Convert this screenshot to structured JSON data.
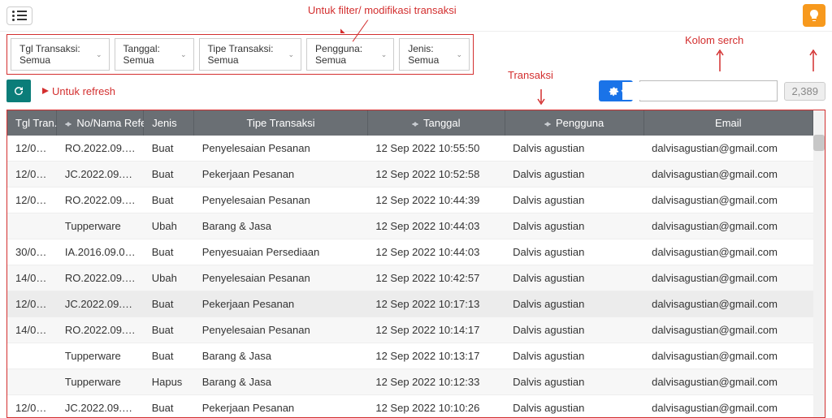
{
  "annotations": {
    "filter": "Untuk filter/ modifikasi transaksi",
    "refresh": "Untuk refresh",
    "transaksi": "Transaksi",
    "search": "Kolom serch"
  },
  "filters": [
    {
      "label": "Tgl Transaksi: Semua"
    },
    {
      "label": "Tanggal: Semua"
    },
    {
      "label": "Tipe Transaksi: Semua"
    },
    {
      "label": "Pengguna: Semua"
    },
    {
      "label": "Jenis: Semua"
    }
  ],
  "search": {
    "placeholder": "",
    "value": ""
  },
  "count": "2,389",
  "columns": [
    {
      "label": "Tgl Tran...",
      "sortable": false,
      "width": "col-tgl"
    },
    {
      "label": "No/Nama Refer...",
      "sortable": true,
      "width": "col-nama"
    },
    {
      "label": "Jenis",
      "sortable": false,
      "width": "col-jenis"
    },
    {
      "label": "Tipe Transaksi",
      "sortable": false,
      "center": true,
      "width": "col-tipe"
    },
    {
      "label": "Tanggal",
      "sortable": true,
      "center": true,
      "width": "col-tanggal"
    },
    {
      "label": "Pengguna",
      "sortable": true,
      "center": true,
      "width": "col-pengguna"
    },
    {
      "label": "Email",
      "sortable": false,
      "center": true,
      "width": "col-email"
    }
  ],
  "rows": [
    {
      "tgl": "12/09/...",
      "nama": "RO.2022.09.0...",
      "jenis": "Buat",
      "tipe": "Penyelesaian Pesanan",
      "tanggal": "12 Sep 2022 10:55:50",
      "pengguna": "Dalvis agustian",
      "email": "dalvisagustian@gmail.com"
    },
    {
      "tgl": "12/09/...",
      "nama": "JC.2022.09.00...",
      "jenis": "Buat",
      "tipe": "Pekerjaan Pesanan",
      "tanggal": "12 Sep 2022 10:52:58",
      "pengguna": "Dalvis agustian",
      "email": "dalvisagustian@gmail.com"
    },
    {
      "tgl": "12/09/...",
      "nama": "RO.2022.09.0...",
      "jenis": "Buat",
      "tipe": "Penyelesaian Pesanan",
      "tanggal": "12 Sep 2022 10:44:39",
      "pengguna": "Dalvis agustian",
      "email": "dalvisagustian@gmail.com"
    },
    {
      "tgl": "",
      "nama": "Tupperware",
      "jenis": "Ubah",
      "tipe": "Barang & Jasa",
      "tanggal": "12 Sep 2022 10:44:03",
      "pengguna": "Dalvis agustian",
      "email": "dalvisagustian@gmail.com"
    },
    {
      "tgl": "30/09/...",
      "nama": "IA.2016.09.00...",
      "jenis": "Buat",
      "tipe": "Penyesuaian Persediaan",
      "tanggal": "12 Sep 2022 10:44:03",
      "pengguna": "Dalvis agustian",
      "email": "dalvisagustian@gmail.com"
    },
    {
      "tgl": "14/09/...",
      "nama": "RO.2022.09.0...",
      "jenis": "Ubah",
      "tipe": "Penyelesaian Pesanan",
      "tanggal": "12 Sep 2022 10:42:57",
      "pengguna": "Dalvis agustian",
      "email": "dalvisagustian@gmail.com"
    },
    {
      "tgl": "12/09/...",
      "nama": "JC.2022.09.00...",
      "jenis": "Buat",
      "tipe": "Pekerjaan Pesanan",
      "tanggal": "12 Sep 2022 10:17:13",
      "pengguna": "Dalvis agustian",
      "email": "dalvisagustian@gmail.com",
      "hl": true
    },
    {
      "tgl": "14/09/...",
      "nama": "RO.2022.09.0...",
      "jenis": "Buat",
      "tipe": "Penyelesaian Pesanan",
      "tanggal": "12 Sep 2022 10:14:17",
      "pengguna": "Dalvis agustian",
      "email": "dalvisagustian@gmail.com"
    },
    {
      "tgl": "",
      "nama": "Tupperware",
      "jenis": "Buat",
      "tipe": "Barang & Jasa",
      "tanggal": "12 Sep 2022 10:13:17",
      "pengguna": "Dalvis agustian",
      "email": "dalvisagustian@gmail.com"
    },
    {
      "tgl": "",
      "nama": "Tupperware",
      "jenis": "Hapus",
      "tipe": "Barang & Jasa",
      "tanggal": "12 Sep 2022 10:12:33",
      "pengguna": "Dalvis agustian",
      "email": "dalvisagustian@gmail.com"
    },
    {
      "tgl": "12/09/...",
      "nama": "JC.2022.09.00...",
      "jenis": "Buat",
      "tipe": "Pekerjaan Pesanan",
      "tanggal": "12 Sep 2022 10:10:26",
      "pengguna": "Dalvis agustian",
      "email": "dalvisagustian@gmail.com"
    }
  ]
}
